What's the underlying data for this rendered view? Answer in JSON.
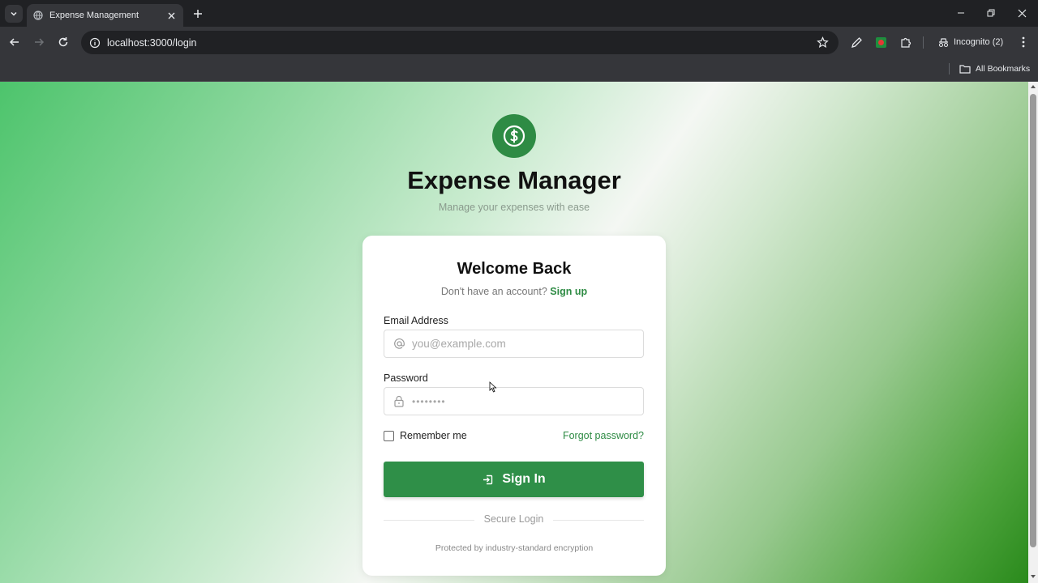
{
  "browser": {
    "tab_title": "Expense Management",
    "url": "localhost:3000/login",
    "incognito_label": "Incognito (2)",
    "all_bookmarks": "All Bookmarks"
  },
  "app": {
    "title": "Expense Manager",
    "subtitle": "Manage your expenses with ease",
    "brand_color": "#2e8b44"
  },
  "login_card": {
    "title": "Welcome Back",
    "signup_prompt": "Don't have an account?",
    "signup_link": "Sign up",
    "email_label": "Email Address",
    "email_placeholder": "you@example.com",
    "password_label": "Password",
    "password_placeholder": "••••••••",
    "remember_label": "Remember me",
    "remember_checked": false,
    "forgot_link": "Forgot password?",
    "signin_label": "Sign In",
    "divider_text": "Secure Login",
    "footer_note": "Protected by industry-standard encryption"
  }
}
